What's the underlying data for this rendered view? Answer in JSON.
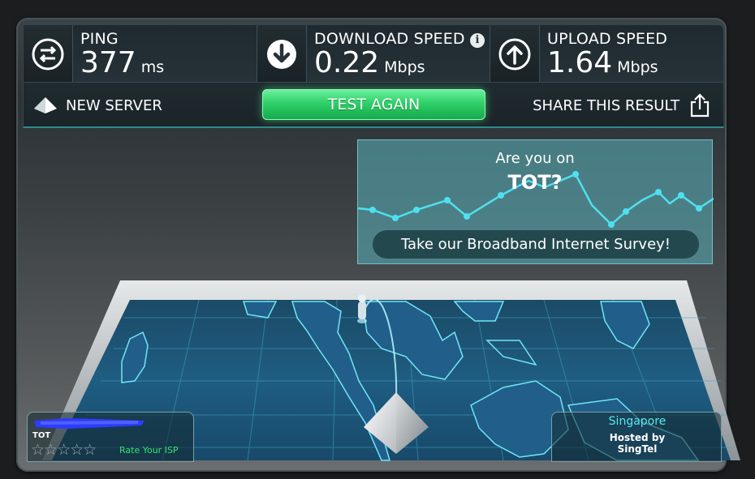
{
  "stats": {
    "ping": {
      "label": "PING",
      "value": "377",
      "unit": "ms",
      "icon": "exchange-arrows-icon"
    },
    "download": {
      "label": "DOWNLOAD SPEED",
      "value": "0.22",
      "unit": "Mbps",
      "icon": "arrow-down-icon"
    },
    "upload": {
      "label": "UPLOAD SPEED",
      "value": "1.64",
      "unit": "Mbps",
      "icon": "arrow-up-icon"
    }
  },
  "actions": {
    "new_server": "NEW SERVER",
    "test_again": "TEST AGAIN",
    "share": "SHARE THIS RESULT"
  },
  "survey": {
    "line1": "Are you on",
    "line2": "TOT?",
    "button": "Take our Broadband Internet Survey!"
  },
  "isp": {
    "name": "TOT",
    "stars": "☆☆☆☆☆",
    "rate_label": "Rate Your ISP"
  },
  "host": {
    "city": "Singapore",
    "hosted_by": "Hosted by",
    "sponsor": "SingTel"
  },
  "colors": {
    "accent_green": "#2fd06a",
    "cyan_text": "#56e9f2",
    "map_blue": "#1f5c86",
    "map_lines": "#5ce4f5"
  }
}
